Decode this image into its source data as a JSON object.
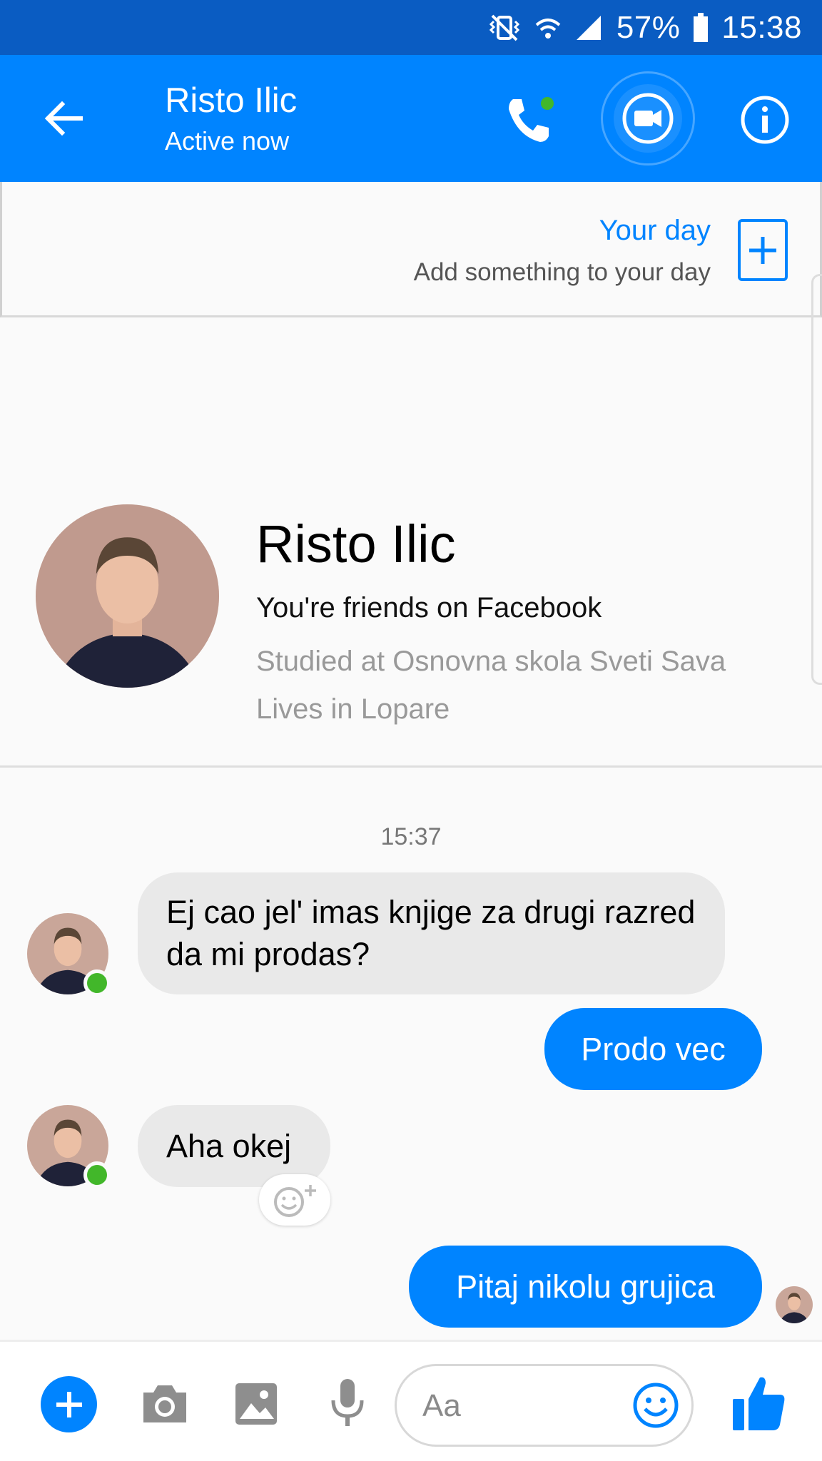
{
  "status_bar": {
    "battery_percent": "57%",
    "time": "15:38",
    "icons": [
      "vibrate-icon",
      "wifi-icon",
      "signal-icon",
      "battery-icon"
    ]
  },
  "header": {
    "title": "Risto Ilic",
    "subtitle": "Active now",
    "icons": [
      "back-arrow-icon",
      "phone-call-icon",
      "video-camera-icon",
      "info-icon"
    ],
    "colors": {
      "bar": "#0084ff",
      "status_bar": "#0a5cc2",
      "online": "#42b72a"
    }
  },
  "your_day": {
    "title": "Your day",
    "subtitle": "Add something to your day"
  },
  "profile": {
    "name": "Risto Ilic",
    "friends_text": "You're friends on Facebook",
    "studied": "Studied at Osnovna skola Sveti Sava",
    "lives": "Lives in Lopare"
  },
  "conversation": {
    "timestamp": "15:37",
    "messages": [
      {
        "from": "them",
        "text": "Ej cao jel' imas knjige za drugi razred da mi prodas?"
      },
      {
        "from": "me",
        "text": "Prodo vec"
      },
      {
        "from": "them",
        "text": "Aha okej"
      },
      {
        "from": "me",
        "text": "Pitaj nikolu grujica"
      }
    ]
  },
  "composer": {
    "placeholder": "Aa",
    "icons": [
      "plus-icon",
      "camera-icon",
      "image-icon",
      "microphone-icon",
      "emoji-icon",
      "thumbs-up-icon"
    ]
  }
}
